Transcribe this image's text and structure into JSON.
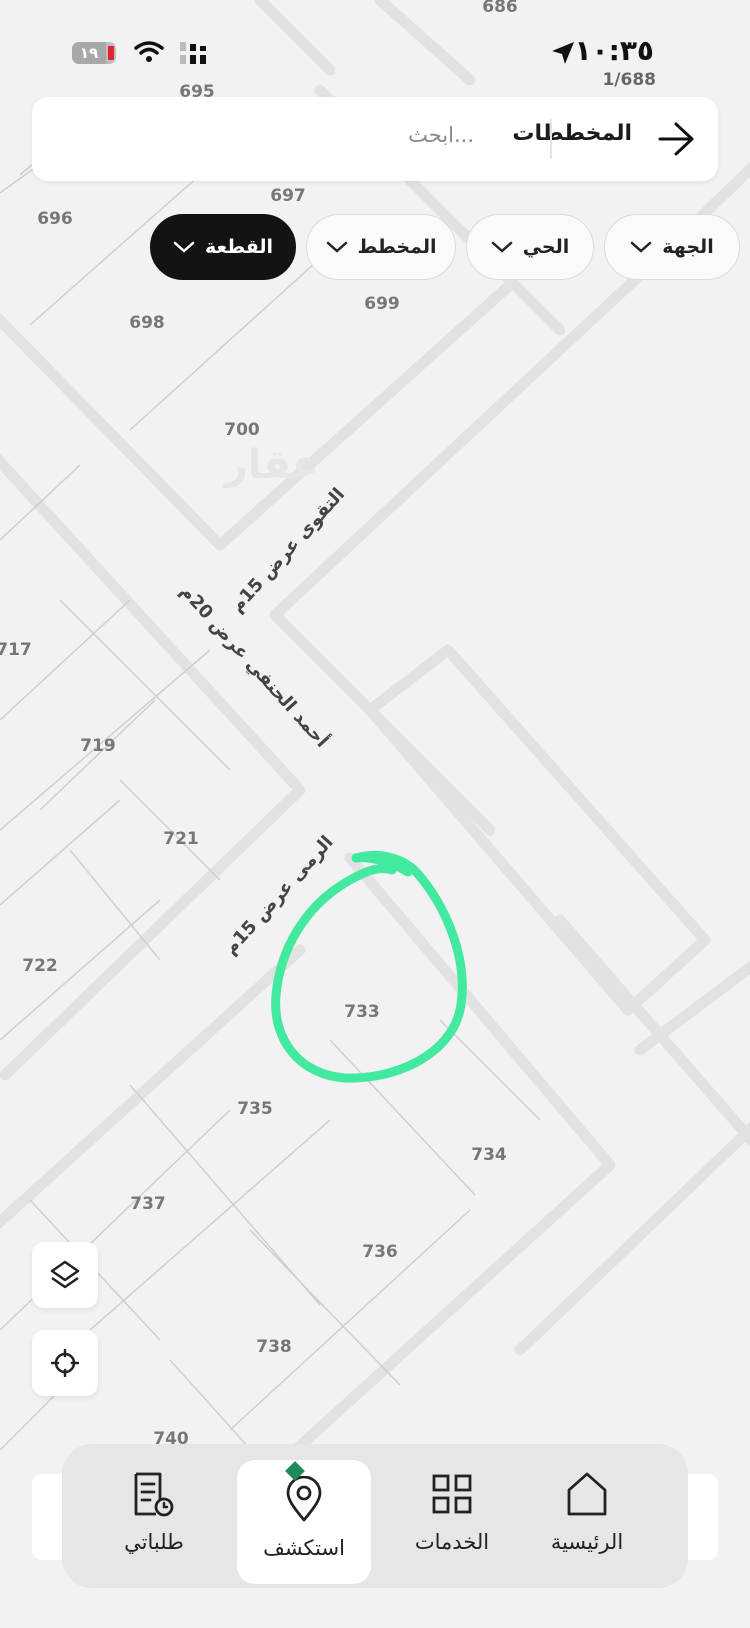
{
  "status_bar": {
    "battery": "١٩",
    "time": "١٠:٣٥"
  },
  "map": {
    "page_indicator": "1/688",
    "plots": [
      "686",
      "695",
      "696",
      "697",
      "698",
      "699",
      "700",
      "717",
      "719",
      "721",
      "722",
      "733",
      "734",
      "735",
      "736",
      "737",
      "738",
      "740"
    ],
    "roads": [
      "التقوى عرض 15م",
      "أحمد الحنفي عرض 20م",
      "الرمى عرض 15م"
    ],
    "watermark": "عقار",
    "highlight_color": "#44e9a0"
  },
  "header": {
    "title": "المخططات",
    "search_placeholder": "ابحث..."
  },
  "filters": [
    {
      "label": "الجهة",
      "active": false
    },
    {
      "label": "الحي",
      "active": false
    },
    {
      "label": "المخطط",
      "active": false
    },
    {
      "label": "القطعة",
      "active": true
    }
  ],
  "map_controls": {
    "layers": "layers-icon",
    "locate": "crosshair-icon"
  },
  "bottom_nav": [
    {
      "label": "الرئيسية",
      "icon": "home-icon",
      "active": false
    },
    {
      "label": "الخدمات",
      "icon": "grid-icon",
      "active": false
    },
    {
      "label": "استكشف",
      "icon": "map-pin-icon",
      "active": true
    },
    {
      "label": "طلباتي",
      "icon": "requests-icon",
      "active": false
    }
  ],
  "colors": {
    "accent": "#1d8a5c",
    "active_chip": "#131313"
  }
}
